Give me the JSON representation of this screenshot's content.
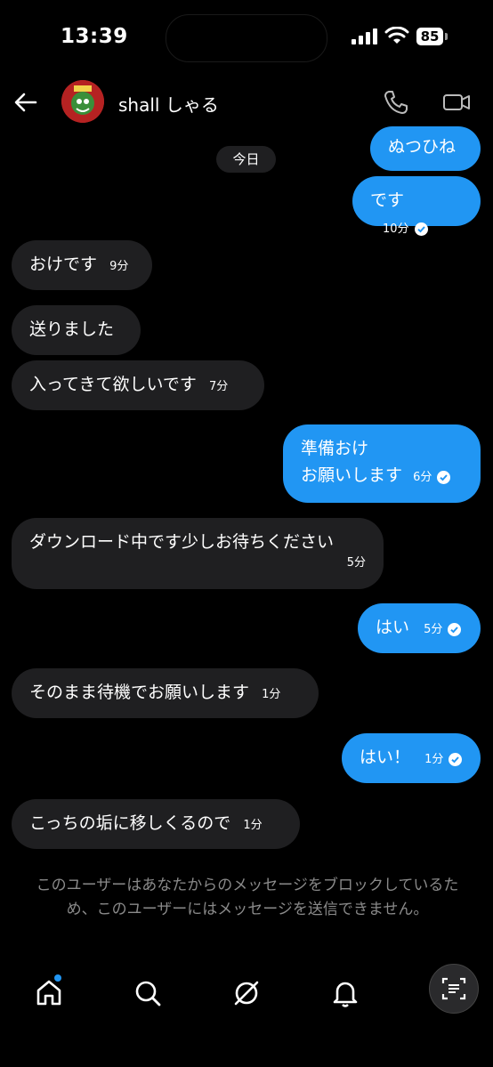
{
  "status": {
    "time": "13:39",
    "battery": "85"
  },
  "header": {
    "contact_name": "shall しゃる"
  },
  "chat": {
    "date_label": "今日",
    "messages": [
      {
        "side": "out",
        "text": "ぬつひね",
        "time": ""
      },
      {
        "side": "out",
        "text": "です",
        "time": "10分",
        "read": true
      },
      {
        "side": "in",
        "text": "おけです",
        "time": "9分"
      },
      {
        "side": "in",
        "text": "送りました",
        "time": ""
      },
      {
        "side": "in",
        "text": "入ってきて欲しいです",
        "time": "7分"
      },
      {
        "side": "out",
        "text": "準備おけ",
        "text2": "お願いします",
        "time": "6分",
        "read": true
      },
      {
        "side": "in",
        "text": "ダウンロード中です少しお待ちください",
        "time": "5分"
      },
      {
        "side": "out",
        "text": "はい",
        "time": "5分",
        "read": true
      },
      {
        "side": "in",
        "text": "そのまま待機でお願いします",
        "time": "1分"
      },
      {
        "side": "out",
        "text": "はい！",
        "time": "1分",
        "read": true
      },
      {
        "side": "in",
        "text": "こっちの垢に移しくるので",
        "time": "1分"
      }
    ]
  },
  "notice": {
    "text": "このユーザーはあなたからのメッセージをブロックしているため、このユーザーにはメッセージを送信できません。"
  },
  "nav": {
    "items": [
      "home-icon",
      "search-icon",
      "explore-icon",
      "notifications-icon",
      "profile-icon"
    ]
  },
  "colors": {
    "outgoing": "#2196f3",
    "incoming": "#1f1f21",
    "background": "#000000"
  }
}
